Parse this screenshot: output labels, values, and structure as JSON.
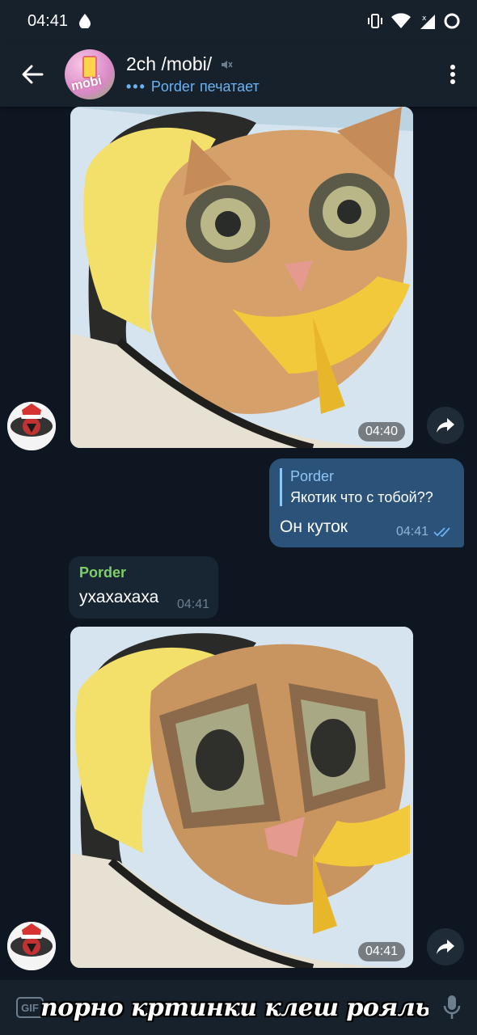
{
  "status_bar": {
    "time": "04:41"
  },
  "header": {
    "title": "2ch /mobi/",
    "typing_user": "Porder",
    "typing_text": "печатает",
    "avatar_text": "mobi"
  },
  "messages": [
    {
      "type": "photo",
      "time": "04:40"
    },
    {
      "type": "outgoing",
      "reply_name": "Porder",
      "reply_text": "Якотик что с тобой??",
      "text": "Он куток",
      "time": "04:41"
    },
    {
      "type": "incoming",
      "sender": "Porder",
      "text": "ухахахаха",
      "time": "04:41"
    },
    {
      "type": "photo",
      "time": "04:41"
    }
  ],
  "input": {
    "gif_label": "GIF",
    "value": "порно кртинки клеш рояль"
  },
  "colors": {
    "background": "#0e1621",
    "header": "#17212b",
    "outgoing_bubble": "#2b5278",
    "incoming_bubble": "#182533",
    "accent": "#6ab3f3",
    "sender_name": "#7ed066"
  }
}
